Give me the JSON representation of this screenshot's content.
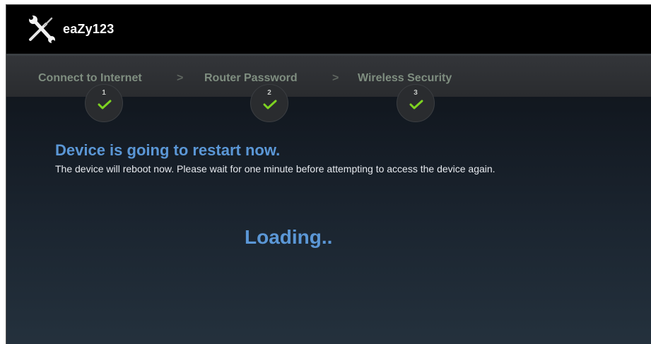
{
  "header": {
    "brand": "eaZy123",
    "logo_icon": "wrench-screwdriver-icon"
  },
  "steps": [
    {
      "label": "Connect to Internet",
      "number": "1",
      "status": "complete"
    },
    {
      "label": "Router Password",
      "number": "2",
      "status": "complete"
    },
    {
      "label": "Wireless Security",
      "number": "3",
      "status": "complete"
    }
  ],
  "step_separator": ">",
  "message": {
    "title": "Device is going to restart now.",
    "body": "The device will reboot now. Please wait for one minute before attempting to access the device again."
  },
  "status": {
    "loading_text": "Loading.."
  },
  "colors": {
    "accent_blue": "#5b97d6",
    "check_green": "#7ed321",
    "step_label": "#7f8e80",
    "topbar": "#000000"
  }
}
